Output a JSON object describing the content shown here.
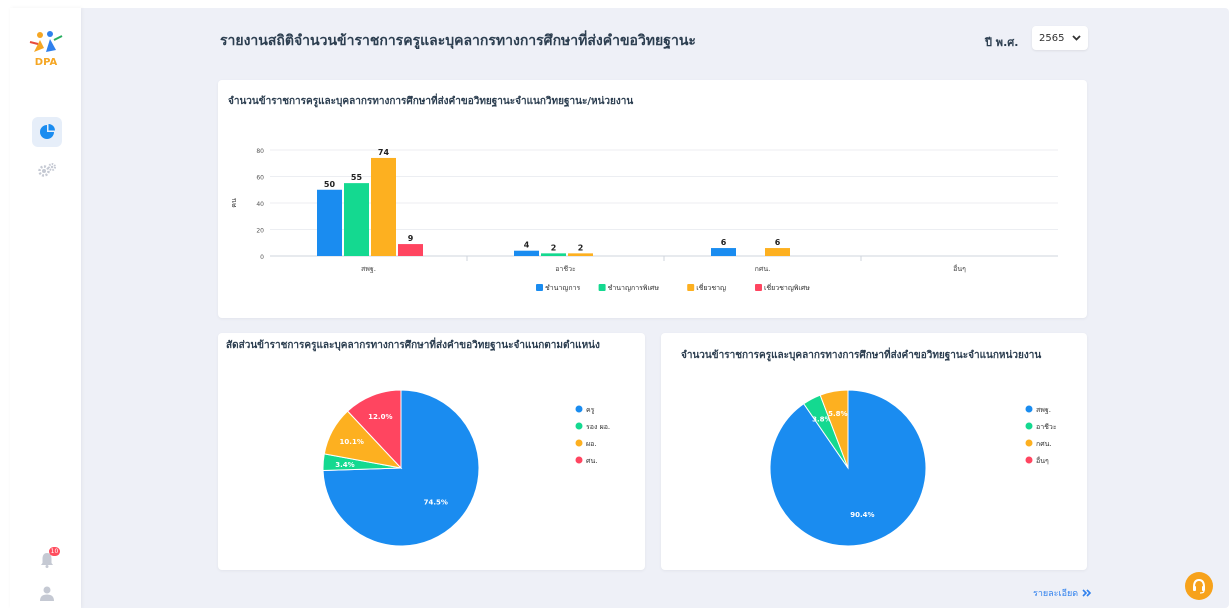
{
  "app": {
    "logo_text": "DPA",
    "notification_count": "10"
  },
  "header": {
    "title": "รายงานสถิติจำนวนข้าราชการครูและบุคลากรทางการศึกษาที่ส่งคำขอวิทยฐานะ",
    "year_label": "ปี พ.ศ.",
    "year_value": "2565"
  },
  "chart_data": [
    {
      "type": "bar",
      "title": "จำนวนข้าราชการครูและบุคลากรทางการศึกษาที่ส่งคำขอวิทยฐานะจำแนกวิทยฐานะ/หน่วยงาน",
      "ylabel": "คน",
      "ylim": [
        0,
        80
      ],
      "yticks": [
        0,
        20,
        40,
        60,
        80
      ],
      "categories": [
        "สพฐ.",
        "อาชีวะ",
        "กศน.",
        "อื่นๆ"
      ],
      "series": [
        {
          "name": "ชำนาญการ",
          "color": "#1a8cf0",
          "values": [
            50,
            4,
            6,
            0
          ]
        },
        {
          "name": "ชำนาญการพิเศษ",
          "color": "#14d990",
          "values": [
            55,
            2,
            0,
            0
          ]
        },
        {
          "name": "เชี่ยวชาญ",
          "color": "#fdb020",
          "values": [
            74,
            2,
            6,
            0
          ]
        },
        {
          "name": "เชี่ยวชาญพิเศษ",
          "color": "#ff4560",
          "values": [
            9,
            0,
            0,
            0
          ]
        }
      ],
      "legend": "bottom"
    },
    {
      "type": "pie",
      "title": "สัดส่วนข้าราชการครูและบุคลากรทางการศึกษาที่ส่งคำขอวิทยฐานะจำแนกตามตำแหน่ง",
      "slices": [
        {
          "label": "ครู",
          "value": 74.5,
          "display": "74.5%",
          "color": "#1a8cf0"
        },
        {
          "label": "รอง ผอ.",
          "value": 3.4,
          "display": "3.4%",
          "color": "#14d990"
        },
        {
          "label": "ผอ.",
          "value": 10.1,
          "display": "10.1%",
          "color": "#fdb020"
        },
        {
          "label": "ศน.",
          "value": 12.0,
          "display": "12.0%",
          "color": "#ff4560"
        }
      ],
      "legend": "right"
    },
    {
      "type": "pie",
      "title": "จำนวนข้าราชการครูและบุคลากรทางการศึกษาที่ส่งคำขอวิทยฐานะจำแนกหน่วยงาน",
      "slices": [
        {
          "label": "สพฐ.",
          "value": 90.4,
          "display": "90.4%",
          "color": "#1a8cf0"
        },
        {
          "label": "อาชีวะ",
          "value": 3.8,
          "display": "3.8%",
          "color": "#14d990"
        },
        {
          "label": "กศน.",
          "value": 5.8,
          "display": "5.8%",
          "color": "#fdb020"
        },
        {
          "label": "อื่นๆ",
          "value": 0,
          "display": "",
          "color": "#ff4560"
        }
      ],
      "legend": "right"
    }
  ],
  "footer": {
    "detail_label": "รายละเอียด"
  },
  "colors": {
    "accent": "#1a8cf0",
    "help": "#f7a21b",
    "background": "#eef0f7"
  }
}
